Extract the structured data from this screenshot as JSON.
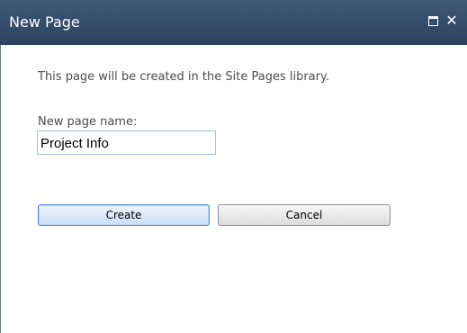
{
  "dialog": {
    "title": "New Page",
    "window_controls": {
      "maximize_icon": "maximize-icon",
      "close_icon": "close-icon",
      "close_glyph": "✕"
    },
    "info_text": "This page will be created in the Site Pages library.",
    "page_name_label": "New page name:",
    "page_name_value": "Project Info",
    "buttons": {
      "create_label": "Create",
      "cancel_label": "Cancel"
    }
  },
  "colors": {
    "title_bar": "#2c4361",
    "title_text": "#ffffff",
    "body_text": "#4c4c4c",
    "input_border": "#a9c1e0",
    "create_border": "#4a8ad6"
  }
}
